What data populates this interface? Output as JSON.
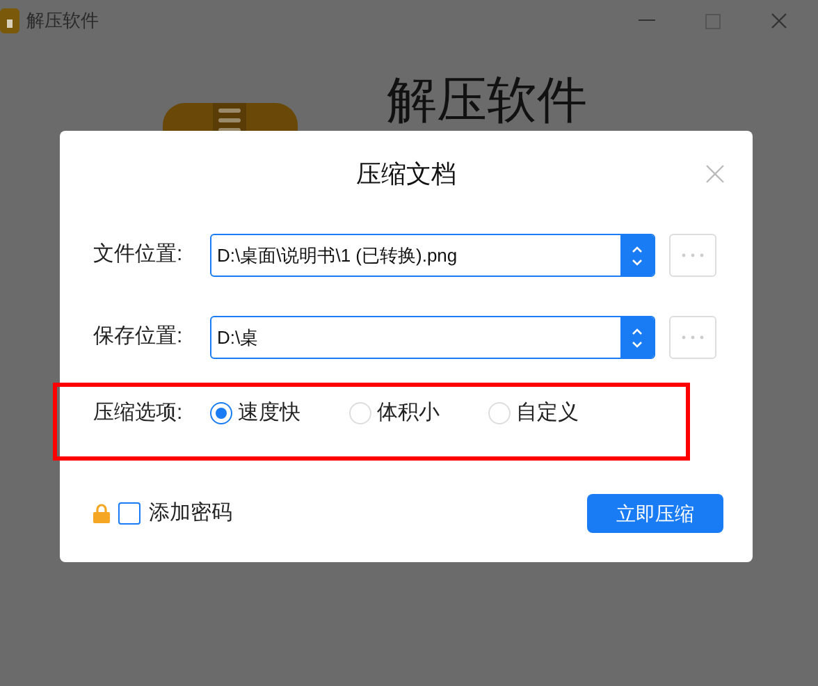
{
  "window": {
    "title": "解压软件"
  },
  "background_heading": "解压软件",
  "dialog": {
    "title": "压缩文档",
    "fields": [
      {
        "label": "文件位置:",
        "value": "D:\\桌面\\说明书\\1 (已转换).png"
      },
      {
        "label": "保存位置:",
        "value": "D:\\桌"
      }
    ],
    "options": {
      "label": "压缩选项:",
      "items": [
        {
          "label": "速度快",
          "selected": true
        },
        {
          "label": "体积小",
          "selected": false
        },
        {
          "label": "自定义",
          "selected": false
        }
      ]
    },
    "password": {
      "label": "添加密码",
      "checked": false
    },
    "submit": "立即压缩"
  }
}
